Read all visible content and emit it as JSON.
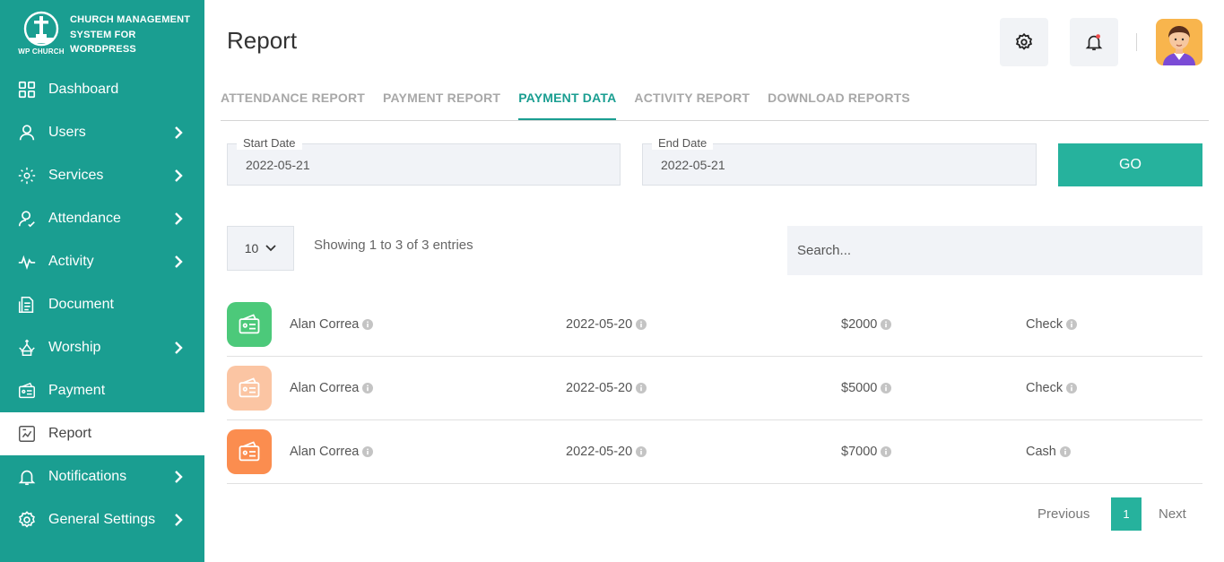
{
  "brand": {
    "mark_text": "WP CHURCH",
    "title_lines": [
      "CHURCH MANAGEMENT",
      "SYSTEM FOR",
      "WORDPRESS"
    ]
  },
  "sidebar": {
    "items": [
      {
        "label": "Dashboard",
        "icon": "grid-icon",
        "has_arrow": false,
        "active": false
      },
      {
        "label": "Users",
        "icon": "user-icon",
        "has_arrow": true,
        "active": false
      },
      {
        "label": "Services",
        "icon": "services-icon",
        "has_arrow": true,
        "active": false
      },
      {
        "label": "Attendance",
        "icon": "attendance-icon",
        "has_arrow": true,
        "active": false
      },
      {
        "label": "Activity",
        "icon": "activity-icon",
        "has_arrow": true,
        "active": false
      },
      {
        "label": "Document",
        "icon": "document-icon",
        "has_arrow": false,
        "active": false
      },
      {
        "label": "Worship",
        "icon": "worship-icon",
        "has_arrow": true,
        "active": false
      },
      {
        "label": "Payment",
        "icon": "payment-icon",
        "has_arrow": false,
        "active": false
      },
      {
        "label": "Report",
        "icon": "report-icon",
        "has_arrow": false,
        "active": true
      },
      {
        "label": "Notifications",
        "icon": "bell-icon",
        "has_arrow": true,
        "active": false
      },
      {
        "label": "General Settings",
        "icon": "gear-icon",
        "has_arrow": true,
        "active": false
      }
    ]
  },
  "header": {
    "title": "Report"
  },
  "tabs": [
    {
      "label": "ATTENDANCE REPORT",
      "active": false
    },
    {
      "label": "PAYMENT REPORT",
      "active": false
    },
    {
      "label": "PAYMENT DATA",
      "active": true
    },
    {
      "label": "ACTIVITY REPORT",
      "active": false
    },
    {
      "label": "DOWNLOAD REPORTS",
      "active": false
    }
  ],
  "filters": {
    "start_label": "Start Date",
    "start_value": "2022-05-21",
    "end_label": "End Date",
    "end_value": "2022-05-21",
    "go_label": "GO"
  },
  "table": {
    "page_length": "10",
    "showing_text": "Showing 1 to 3 of 3 entries",
    "search_placeholder": "Search...",
    "rows": [
      {
        "name": "Alan Correa",
        "date": "2022-05-20",
        "amount": "$2000",
        "mode": "Check",
        "badge_color": "#4cc97a"
      },
      {
        "name": "Alan Correa",
        "date": "2022-05-20",
        "amount": "$5000",
        "mode": "Check",
        "badge_color": "#fbc5a3"
      },
      {
        "name": "Alan Correa",
        "date": "2022-05-20",
        "amount": "$7000",
        "mode": "Cash",
        "badge_color": "#fb8d4f"
      }
    ]
  },
  "pagination": {
    "previous": "Previous",
    "current": "1",
    "next": "Next"
  },
  "colors": {
    "sidebar": "#1a9e91",
    "accent": "#26b29d"
  }
}
